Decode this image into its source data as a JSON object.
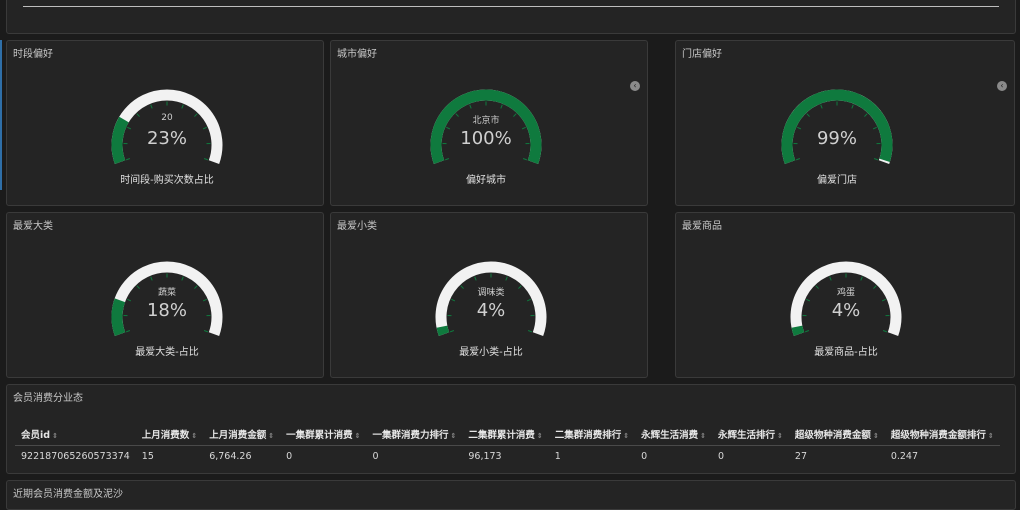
{
  "colors": {
    "accent": "#0f7a3e",
    "track": "#f2f2f2",
    "background": "#1b1b1b",
    "panel": "#242424"
  },
  "gauges": [
    {
      "title": "时段偏好",
      "top_value": "20",
      "percent": "23%",
      "fraction": 0.23,
      "label": "时间段-购买次数占比",
      "has_nav": false
    },
    {
      "title": "城市偏好",
      "top_value": "北京市",
      "percent": "100%",
      "fraction": 1.0,
      "label": "偏好城市",
      "has_nav": true
    },
    {
      "title": "门店偏好",
      "top_value": "",
      "percent": "99%",
      "fraction": 0.99,
      "label": "偏爱门店",
      "has_nav": true
    },
    {
      "title": "最爱大类",
      "top_value": "蔬菜",
      "percent": "18%",
      "fraction": 0.18,
      "label": "最爱大类-占比",
      "has_nav": false
    },
    {
      "title": "最爱小类",
      "top_value": "调味类",
      "percent": "4%",
      "fraction": 0.04,
      "label": "最爱小类-占比",
      "has_nav": false
    },
    {
      "title": "最爱商品",
      "top_value": "鸡蛋",
      "percent": "4%",
      "fraction": 0.04,
      "label": "最爱商品-占比",
      "has_nav": false
    }
  ],
  "nav_icon": "chevron-left-icon",
  "table_panel": {
    "title": "会员消费分业态",
    "columns": [
      "会员id",
      "上月消费数",
      "上月消费金额",
      "一集群累计消费",
      "一集群消费力排行",
      "二集群累计消费",
      "二集群消费排行",
      "永辉生活消费",
      "永辉生活排行",
      "超级物种消费金额",
      "超级物种消费金额排行"
    ],
    "rows": [
      [
        "922187065260573374",
        "15",
        "6,764.26",
        "0",
        "0",
        "96,173",
        "1",
        "0",
        "0",
        "27",
        "0.247"
      ]
    ]
  },
  "bottom_panel": {
    "title": "近期会员消费金额及泥沙"
  }
}
